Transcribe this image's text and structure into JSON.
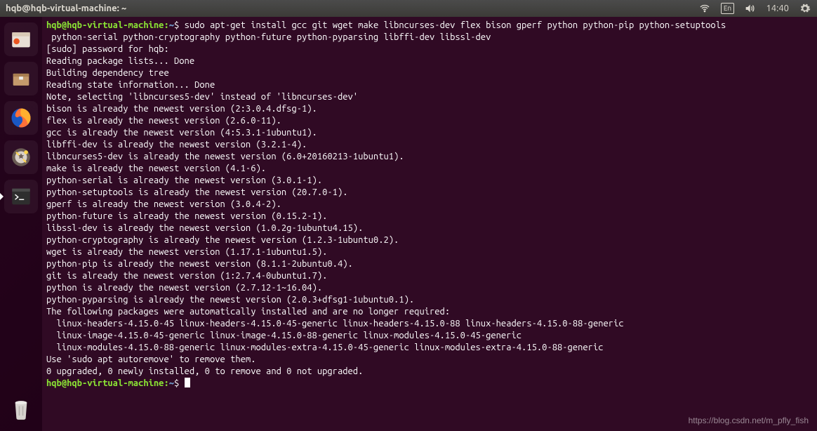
{
  "titlebar": {
    "title": "hqb@hqb-virtual-machine: ~",
    "lang": "En",
    "time": "14:40"
  },
  "launcher": {
    "items": [
      {
        "name": "files-app-icon"
      },
      {
        "name": "archive-app-icon"
      },
      {
        "name": "firefox-icon"
      },
      {
        "name": "settings-app-icon"
      },
      {
        "name": "terminal-icon"
      }
    ],
    "trash": "trash-icon"
  },
  "terminal": {
    "prompt_user": "hqb@hqb-virtual-machine",
    "prompt_path": "~",
    "prompt_sep": ":",
    "prompt_end": "$ ",
    "command": "sudo apt-get install gcc git wget make libncurses-dev flex bison gperf python python-pip python-setuptools python-serial python-cryptography python-future python-pyparsing libffi-dev libssl-dev",
    "lines": [
      "[sudo] password for hqb:",
      "Reading package lists... Done",
      "Building dependency tree",
      "Reading state information... Done",
      "Note, selecting 'libncurses5-dev' instead of 'libncurses-dev'",
      "bison is already the newest version (2:3.0.4.dfsg-1).",
      "flex is already the newest version (2.6.0-11).",
      "gcc is already the newest version (4:5.3.1-1ubuntu1).",
      "libffi-dev is already the newest version (3.2.1-4).",
      "libncurses5-dev is already the newest version (6.0+20160213-1ubuntu1).",
      "make is already the newest version (4.1-6).",
      "python-serial is already the newest version (3.0.1-1).",
      "python-setuptools is already the newest version (20.7.0-1).",
      "gperf is already the newest version (3.0.4-2).",
      "python-future is already the newest version (0.15.2-1).",
      "libssl-dev is already the newest version (1.0.2g-1ubuntu4.15).",
      "python-cryptography is already the newest version (1.2.3-1ubuntu0.2).",
      "wget is already the newest version (1.17.1-1ubuntu1.5).",
      "python-pip is already the newest version (8.1.1-2ubuntu0.4).",
      "git is already the newest version (1:2.7.4-0ubuntu1.7).",
      "python is already the newest version (2.7.12-1~16.04).",
      "python-pyparsing is already the newest version (2.0.3+dfsg1-1ubuntu0.1).",
      "The following packages were automatically installed and are no longer required:",
      "  linux-headers-4.15.0-45 linux-headers-4.15.0-45-generic linux-headers-4.15.0-88 linux-headers-4.15.0-88-generic",
      "  linux-image-4.15.0-45-generic linux-image-4.15.0-88-generic linux-modules-4.15.0-45-generic",
      "  linux-modules-4.15.0-88-generic linux-modules-extra-4.15.0-45-generic linux-modules-extra-4.15.0-88-generic",
      "Use 'sudo apt autoremove' to remove them.",
      "0 upgraded, 0 newly installed, 0 to remove and 0 not upgraded."
    ]
  },
  "watermark": "https://blog.csdn.net/m_pfly_fish"
}
